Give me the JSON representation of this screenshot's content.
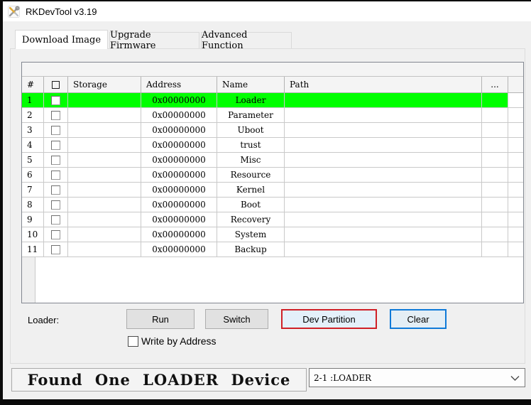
{
  "window": {
    "title": "RKDevTool v3.19"
  },
  "tabs": [
    {
      "label": "Download Image",
      "active": true
    },
    {
      "label": "Upgrade Firmware",
      "active": false
    },
    {
      "label": "Advanced Function",
      "active": false
    }
  ],
  "table": {
    "columns": [
      "#",
      "select-all",
      "Storage",
      "Address",
      "Name",
      "Path",
      "..."
    ],
    "rows": [
      {
        "num": "1",
        "checked": false,
        "storage": "",
        "address": "0x00000000",
        "name": "Loader",
        "path": "",
        "selected": true
      },
      {
        "num": "2",
        "checked": false,
        "storage": "",
        "address": "0x00000000",
        "name": "Parameter",
        "path": "",
        "selected": false
      },
      {
        "num": "3",
        "checked": false,
        "storage": "",
        "address": "0x00000000",
        "name": "Uboot",
        "path": "",
        "selected": false
      },
      {
        "num": "4",
        "checked": false,
        "storage": "",
        "address": "0x00000000",
        "name": "trust",
        "path": "",
        "selected": false
      },
      {
        "num": "5",
        "checked": false,
        "storage": "",
        "address": "0x00000000",
        "name": "Misc",
        "path": "",
        "selected": false
      },
      {
        "num": "6",
        "checked": false,
        "storage": "",
        "address": "0x00000000",
        "name": "Resource",
        "path": "",
        "selected": false
      },
      {
        "num": "7",
        "checked": false,
        "storage": "",
        "address": "0x00000000",
        "name": "Kernel",
        "path": "",
        "selected": false
      },
      {
        "num": "8",
        "checked": false,
        "storage": "",
        "address": "0x00000000",
        "name": "Boot",
        "path": "",
        "selected": false
      },
      {
        "num": "9",
        "checked": false,
        "storage": "",
        "address": "0x00000000",
        "name": "Recovery",
        "path": "",
        "selected": false
      },
      {
        "num": "10",
        "checked": false,
        "storage": "",
        "address": "0x00000000",
        "name": "System",
        "path": "",
        "selected": false
      },
      {
        "num": "11",
        "checked": false,
        "storage": "",
        "address": "0x00000000",
        "name": "Backup",
        "path": "",
        "selected": false
      }
    ]
  },
  "controls": {
    "loader_label": "Loader:",
    "run_label": "Run",
    "switch_label": "Switch",
    "dev_partition_label": "Dev Partition",
    "clear_label": "Clear",
    "write_by_address_label": "Write by Address",
    "write_by_address_checked": false
  },
  "status": {
    "message": "Found One LOADER Device",
    "device_selected": "2-1 :LOADER"
  },
  "colors": {
    "selected_row": "#00ff00",
    "annotation_border": "#cf2027",
    "focus_border": "#0f7ad8"
  }
}
